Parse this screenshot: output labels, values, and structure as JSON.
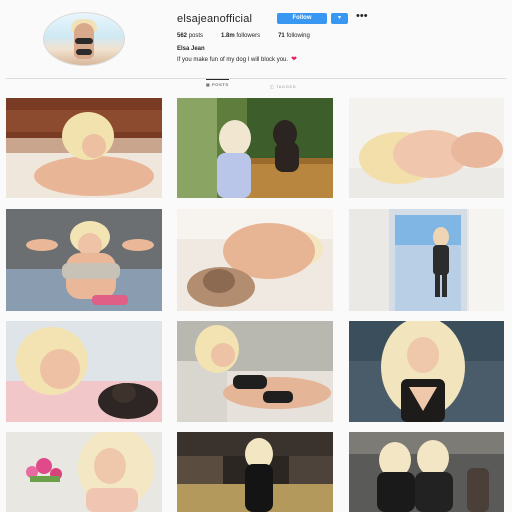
{
  "profile": {
    "username": "elsajeanofficial",
    "follow_label": "Follow",
    "more_label": "▾",
    "options_label": "•••",
    "stats": {
      "posts_value": "562",
      "posts_label": "posts",
      "followers_value": "1.8m",
      "followers_label": "followers",
      "following_value": "71",
      "following_label": "following"
    },
    "full_name": "Elsa Jean",
    "bio": "If you make fun of my dog I will block you."
  },
  "tabs": {
    "posts": "POSTS",
    "tagged": "TAGGED"
  },
  "colors": {
    "follow_blue": "#3897f0",
    "heart_red": "#e0245e"
  }
}
